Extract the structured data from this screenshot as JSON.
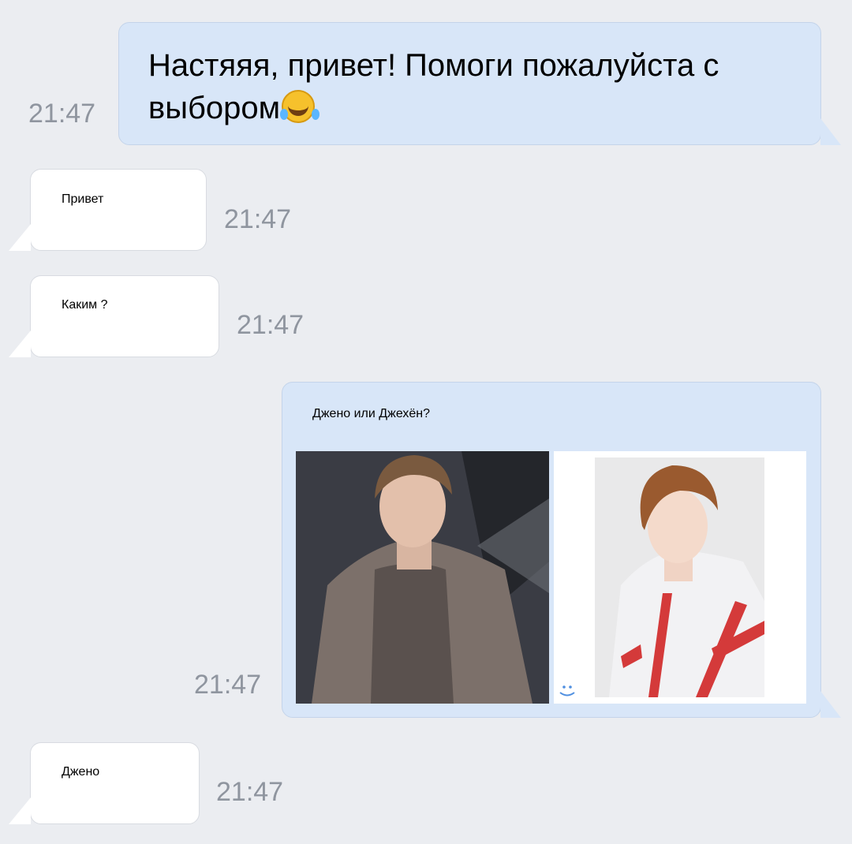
{
  "messages": [
    {
      "direction": "outgoing",
      "text_line1": "Настяяя, привет! Помоги пожалуйста с",
      "text_line2": "выбором",
      "emoji": "face-with-tears-of-joy",
      "time": "21:47"
    },
    {
      "direction": "incoming",
      "text": "Привет",
      "time": "21:47"
    },
    {
      "direction": "incoming",
      "text": "Каким ?",
      "time": "21:47"
    },
    {
      "direction": "outgoing",
      "text": "Джено или Джехён?",
      "time": "21:47",
      "attachments": [
        "photo",
        "photo"
      ]
    },
    {
      "direction": "incoming",
      "text": "Джено",
      "time": "21:47"
    }
  ],
  "colors": {
    "background": "#ebedf1",
    "outgoing_bubble": "#d8e6f8",
    "incoming_bubble": "#ffffff",
    "timestamp": "#8f959f"
  }
}
